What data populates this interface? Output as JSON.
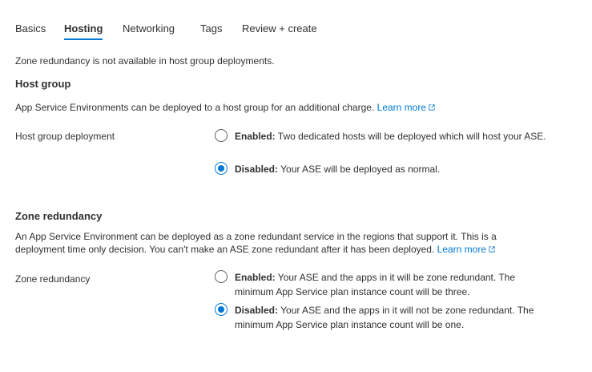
{
  "tabs": [
    "Basics",
    "Hosting",
    "Networking",
    "Tags",
    "Review + create"
  ],
  "active_tab": "Hosting",
  "notice": "Zone redundancy is not available in host group deployments.",
  "host_group": {
    "title": "Host group",
    "description": "App Service Environments can be deployed to a host group for an additional charge.",
    "learn_more": "Learn more",
    "field_label": "Host group deployment",
    "options": [
      {
        "label": "Enabled:",
        "text": "Two dedicated hosts will be deployed which will host your ASE.",
        "checked": false
      },
      {
        "label": "Disabled:",
        "text": "Your ASE will be deployed as normal.",
        "checked": true
      }
    ]
  },
  "zone_redundancy": {
    "title": "Zone redundancy",
    "description_line1": "An App Service Environment can be deployed as a zone redundant service in the regions that support it. This is a",
    "description_line2": "deployment time only decision. You can't make an ASE zone redundant after it has been deployed.",
    "learn_more": "Learn more",
    "field_label": "Zone redundancy",
    "options": [
      {
        "label": "Enabled:",
        "text": "Your ASE and the apps in it will be zone redundant. The minimum App Service plan instance count will be three.",
        "checked": false
      },
      {
        "label": "Disabled:",
        "text": "Your ASE and the apps in it will not be zone redundant. The minimum App Service plan instance count will be one.",
        "checked": true
      }
    ]
  },
  "colors": {
    "accent": "#0078d4",
    "text": "#323130"
  }
}
